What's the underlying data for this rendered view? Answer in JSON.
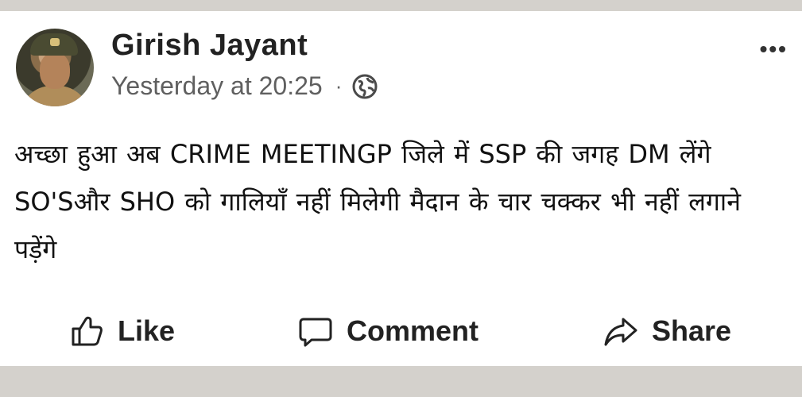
{
  "post": {
    "author": "Girish Jayant",
    "timestamp": "Yesterday at 20:25",
    "separator": "·",
    "privacy_icon": "globe-icon",
    "more_icon": "•••",
    "text": "अच्छा हुआ अब CRIME MEETINGP जिले में SSP की जगह DM लेंगे SO'Sऔर SHO को गालियाँ नहीं मिलेगी मैदान के चार चक्कर भी नहीं लगाने पड़ेंगे"
  },
  "actions": {
    "like_label": "Like",
    "comment_label": "Comment",
    "share_label": "Share"
  },
  "colors": {
    "background": "#d4d1cc",
    "card": "#ffffff",
    "text": "#111111",
    "meta_text": "#5f5f5f"
  }
}
